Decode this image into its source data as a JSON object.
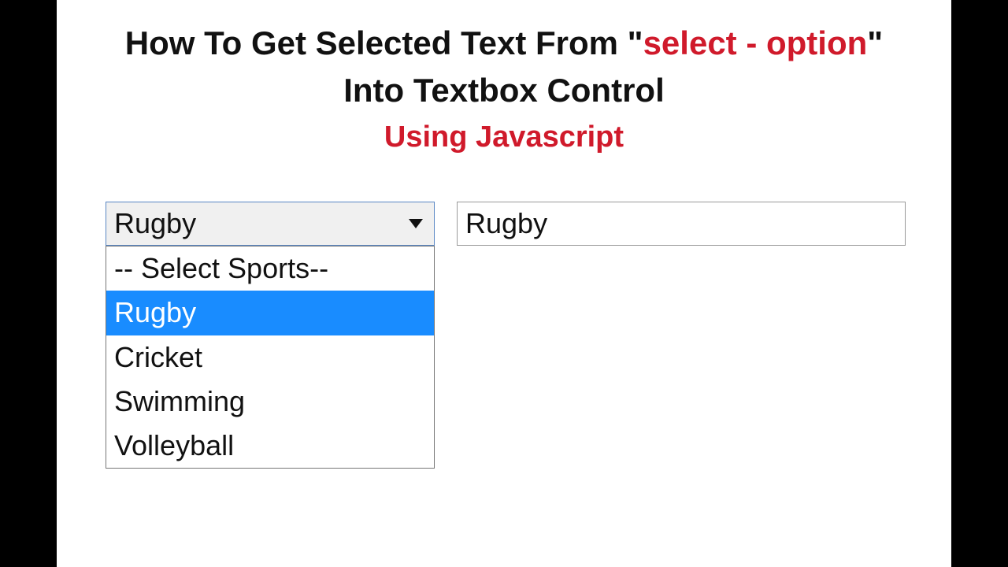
{
  "heading": {
    "line1_prefix": "How To Get Selected Text From \"",
    "line1_accent": "select - option",
    "line1_suffix": "\"",
    "line2": "Into Textbox Control",
    "line3": "Using Javascript"
  },
  "select": {
    "current": "Rugby",
    "options": [
      {
        "label": "-- Select Sports--",
        "selected": false
      },
      {
        "label": "Rugby",
        "selected": true
      },
      {
        "label": "Cricket",
        "selected": false
      },
      {
        "label": "Swimming",
        "selected": false
      },
      {
        "label": "Volleyball",
        "selected": false
      }
    ]
  },
  "textbox": {
    "value": "Rugby"
  },
  "colors": {
    "accent": "#d01a2b",
    "selection": "#198cff"
  }
}
